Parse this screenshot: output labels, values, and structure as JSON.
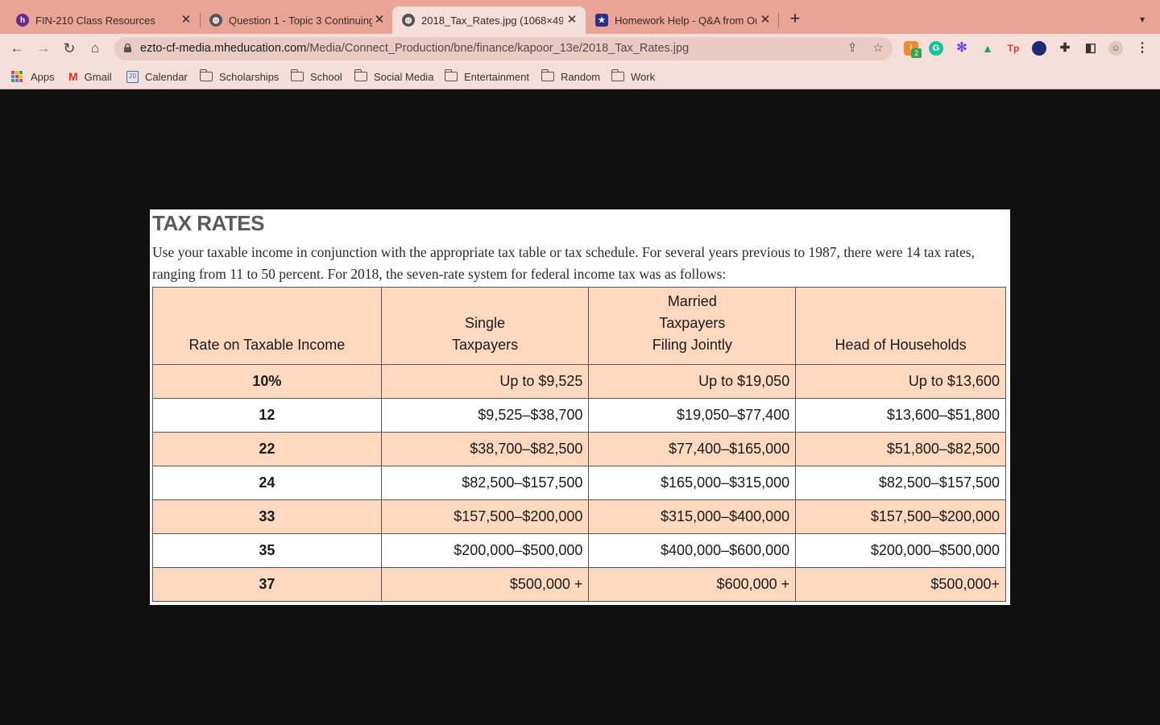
{
  "browser": {
    "tabs": [
      {
        "title": "FIN-210 Class Resources",
        "icon": "hypothesis-favicon",
        "color": "#6c2a8c"
      },
      {
        "title": "Question 1 - Topic 3 Continuing",
        "icon": "globe-favicon",
        "color": "#555555"
      },
      {
        "title": "2018_Tax_Rates.jpg (1068×49",
        "icon": "globe-favicon",
        "color": "#555555"
      },
      {
        "title": "Homework Help - Q&A from Or",
        "icon": "star-favicon",
        "color": "#2b2f8c"
      }
    ],
    "new_tab_label": "+",
    "url_host": "ezto-cf-media.mheducation.com",
    "url_path": "/Media/Connect_Production/bne/finance/kapoor_13e/2018_Tax_Rates.jpg",
    "extension_badge": "2"
  },
  "bookmarks": [
    {
      "label": "Apps",
      "icon": "apps-grid-icon"
    },
    {
      "label": "Gmail",
      "icon": "gmail-icon"
    },
    {
      "label": "Calendar",
      "icon": "calendar-icon",
      "icon_text": "20"
    },
    {
      "label": "Scholarships",
      "icon": "folder-icon"
    },
    {
      "label": "School",
      "icon": "folder-icon"
    },
    {
      "label": "Social Media",
      "icon": "folder-icon"
    },
    {
      "label": "Entertainment",
      "icon": "folder-icon"
    },
    {
      "label": "Random",
      "icon": "folder-icon"
    },
    {
      "label": "Work",
      "icon": "folder-icon"
    }
  ],
  "document": {
    "title": "TAX RATES",
    "description": "Use your taxable income in conjunction with the appropriate tax table or tax schedule. For several years previous to 1987, there were 14 tax rates, ranging from 11 to 50 percent. For 2018, the seven-rate system for federal income tax was as follows:",
    "table": {
      "headers": [
        [
          "Rate on Taxable Income"
        ],
        [
          "Single",
          "Taxpayers"
        ],
        [
          "Married",
          "Taxpayers",
          "Filing Jointly"
        ],
        [
          "Head of Households"
        ]
      ],
      "rows": [
        [
          "10%",
          "Up to $9,525",
          "Up to $19,050",
          "Up to $13,600"
        ],
        [
          "12",
          "$9,525–$38,700",
          "$19,050–$77,400",
          "$13,600–$51,800"
        ],
        [
          "22",
          "$38,700–$82,500",
          "$77,400–$165,000",
          "$51,800–$82,500"
        ],
        [
          "24",
          "$82,500–$157,500",
          "$165,000–$315,000",
          "$82,500–$157,500"
        ],
        [
          "33",
          "$157,500–$200,000",
          "$315,000–$400,000",
          "$157,500–$200,000"
        ],
        [
          "35",
          "$200,000–$500,000",
          "$400,000–$600,000",
          "$200,000–$500,000"
        ],
        [
          "37",
          "$500,000 +",
          "$600,000 +",
          "$500,000+"
        ]
      ]
    }
  },
  "colors": {
    "tab_strip": "#e8a596",
    "toolbar": "#f6dfd9",
    "page_background": "#0f0f0f",
    "table_shade": "#fed8bf"
  }
}
